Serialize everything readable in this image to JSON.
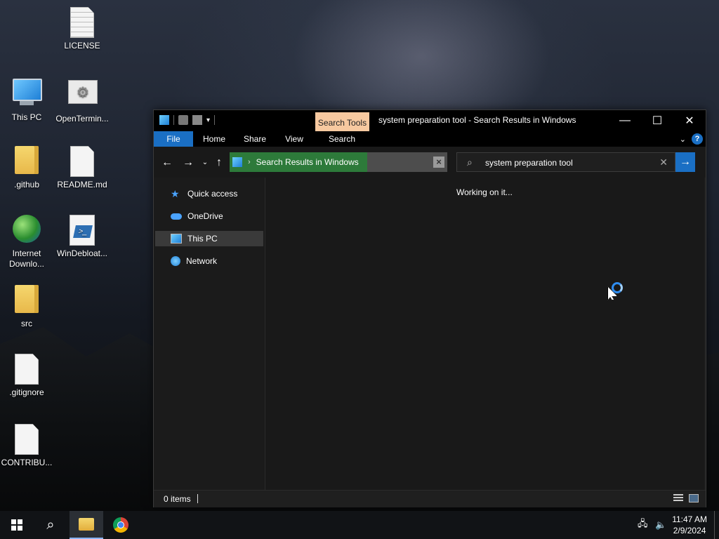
{
  "desktop": {
    "icons": [
      {
        "label": "LICENSE",
        "icon": "text-file-icon"
      },
      {
        "label": "This PC",
        "icon": "this-pc-icon"
      },
      {
        "label": "OpenTermin...",
        "icon": "settings-file-icon"
      },
      {
        "label": ".github",
        "icon": "folder-icon"
      },
      {
        "label": "README.md",
        "icon": "file-icon"
      },
      {
        "label": "Internet\nDownlo...",
        "icon": "internet-download-manager-icon"
      },
      {
        "label": "WinDebloat...",
        "icon": "powershell-script-icon"
      },
      {
        "label": "src",
        "icon": "folder-icon"
      },
      {
        "label": ".gitignore",
        "icon": "file-icon"
      },
      {
        "label": "CONTRIBU...",
        "icon": "file-icon"
      }
    ]
  },
  "window": {
    "title": "system preparation tool - Search Results in Windows",
    "contextual_tab": "Search Tools",
    "controls": {
      "minimize": "—",
      "maximize": "☐",
      "close": "✕"
    },
    "ribbon_tabs": [
      "File",
      "Home",
      "Share",
      "View",
      "Search"
    ],
    "address": {
      "location": "Search Results in Windows",
      "separator": "›"
    },
    "search": {
      "query": "system preparation tool"
    },
    "nav_pane": [
      {
        "label": "Quick access",
        "icon": "star-icon",
        "selected": false
      },
      {
        "label": "OneDrive",
        "icon": "cloud-icon",
        "selected": false
      },
      {
        "label": "This PC",
        "icon": "monitor-icon",
        "selected": true
      },
      {
        "label": "Network",
        "icon": "network-icon",
        "selected": false
      }
    ],
    "content": {
      "status_message": "Working on it..."
    },
    "status_bar": {
      "item_count": "0 items"
    }
  },
  "taskbar": {
    "clock": {
      "time": "11:47 AM",
      "date": "2/9/2024"
    },
    "pinned": [
      "start-button",
      "search-button",
      "file-explorer",
      "chrome"
    ]
  },
  "colors": {
    "accent": "#1a6fc4",
    "search_tools_tab": "#f7c9a0",
    "address_highlight": "#2d7a3a",
    "window_bg": "#1f1f1f"
  }
}
